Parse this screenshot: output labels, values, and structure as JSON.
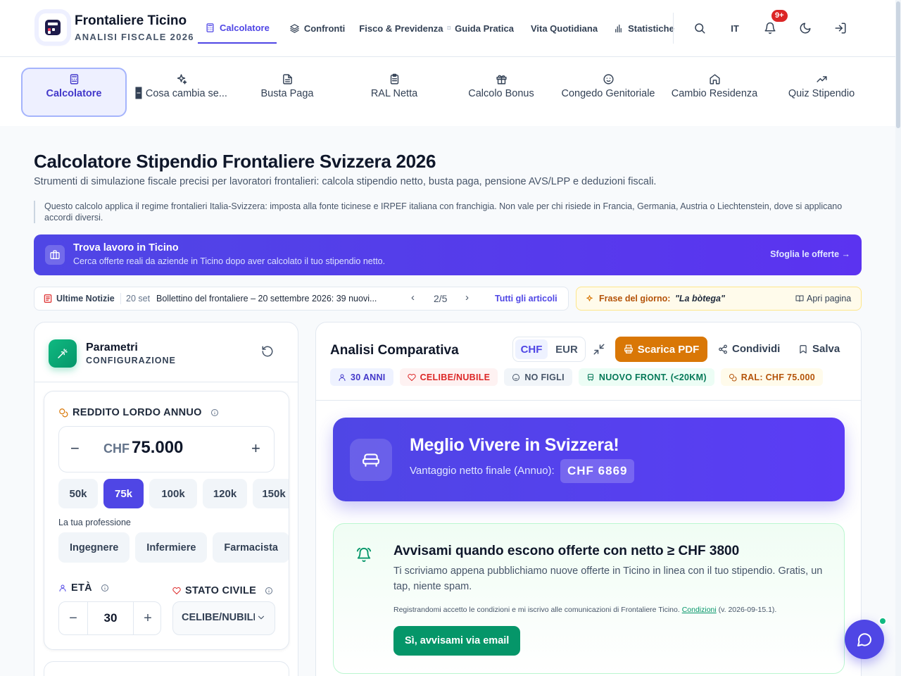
{
  "header": {
    "brand_name": "Frontaliere Ticino",
    "brand_sub": "ANALISI FISCALE 2026",
    "nav": [
      {
        "label": "Calcolatore",
        "icon": "calculator-icon",
        "active": true
      },
      {
        "label": "Confronti",
        "icon": "layers-icon"
      },
      {
        "label": "Fisco & Previdenza",
        "icon": ""
      },
      {
        "label": "Guida Pratica",
        "icon": ""
      },
      {
        "label": "Vita Quotidiana",
        "icon": ""
      },
      {
        "label": "Statistiche",
        "icon": "bar-chart-icon"
      }
    ],
    "lang": "IT",
    "notif_badge": "9+"
  },
  "tools": [
    {
      "label": "Calcolatore",
      "icon": "calculator-icon",
      "active": true
    },
    {
      "label": "🁢 Cosa cambia se...",
      "icon": "sparkles-icon"
    },
    {
      "label": "Busta Paga",
      "icon": "file-text-icon"
    },
    {
      "label": "RAL Netta",
      "icon": "clipboard-icon"
    },
    {
      "label": "Calcolo Bonus",
      "icon": "gift-icon"
    },
    {
      "label": "Congedo Genitoriale",
      "icon": "baby-icon"
    },
    {
      "label": "Cambio Residenza",
      "icon": "home-icon"
    },
    {
      "label": "Quiz Stipendio",
      "icon": "trending-up-icon"
    }
  ],
  "intro": {
    "title": "Calcolatore Stipendio Frontaliere Svizzera 2026",
    "subtitle": "Strumenti di simulazione fiscale precisi per lavoratori frontalieri: calcola stipendio netto, busta paga, pensione AVS/LPP e deduzioni fiscali.",
    "disclaimer": "Questo calcolo applica il regime frontalieri Italia-Svizzera: imposta alla fonte ticinese e IRPEF italiana con franchigia. Non vale per chi risiede in Francia, Germania, Austria o Liechtenstein, dove si applicano accordi diversi."
  },
  "job_banner": {
    "title": "Trova lavoro in Ticino",
    "desc": "Cerca offerte reali da aziende in Ticino dopo aver calcolato il tuo stipendio netto.",
    "link": "Sfoglia le offerte →"
  },
  "news": {
    "label": "Ultime Notizie",
    "date": "20 set",
    "headline": "Bollettino del frontaliere – 20 settembre 2026: 39 nuovi...",
    "pager": "2/5",
    "all_link": "Tutti gli articoli"
  },
  "phrase": {
    "label": "Frase del giorno:",
    "text": "\"La bòtega\"",
    "open": "Apri pagina"
  },
  "params": {
    "title": "Parametri",
    "subtitle": "CONFIGURAZIONE",
    "income_label": "REDDITO LORDO ANNUO",
    "currency": "CHF",
    "income_value": "75.000",
    "quick": [
      "50k",
      "75k",
      "100k",
      "120k",
      "150k"
    ],
    "quick_active": 1,
    "profession_label": "La tua professione",
    "professions": [
      "Ingegnere",
      "Infermiere",
      "Farmacista"
    ],
    "age_label": "ETÀ",
    "age_value": "30",
    "status_label": "STATO CIVILE",
    "status_value": "CELIBE/NUBILE"
  },
  "analysis": {
    "title": "Analisi Comparativa",
    "currencies": [
      "CHF",
      "EUR"
    ],
    "active_currency": "CHF",
    "pdf": "Scarica PDF",
    "share": "Condividi",
    "save": "Salva",
    "tags": [
      {
        "label": "30 ANNI",
        "icon": "user-icon",
        "color": "#4338ca",
        "bg": "#eef2ff"
      },
      {
        "label": "CELIBE/NUBILE",
        "icon": "heart-icon",
        "color": "#dc2626",
        "bg": "#fef2f2"
      },
      {
        "label": "NO FIGLI",
        "icon": "baby-icon",
        "color": "#475569",
        "bg": "#f1f5f9"
      },
      {
        "label": "NUOVO FRONT. (<20KM)",
        "icon": "bus-icon",
        "color": "#047857",
        "bg": "#ecfdf5"
      },
      {
        "label": "RAL: CHF 75.000",
        "icon": "coins-icon",
        "color": "#b45309",
        "bg": "#fffbeb"
      }
    ],
    "hero_title": "Meglio Vivere in Svizzera!",
    "hero_sub": "Vantaggio netto finale (Annuo):",
    "hero_value": "CHF 6869",
    "alert_title": "Avvisami quando escono offerte con netto ≥ CHF 3800",
    "alert_desc": "Ti scriviamo appena pubblichiamo nuove offerte in Ticino in linea con il tuo stipendio. Gratis, un tap, niente spam.",
    "alert_legal_pre": "Registrandomi accetto le condizioni e mi iscrivo alle comunicazioni di Frontaliere Ticino.",
    "alert_legal_link": "Condizioni",
    "alert_legal_post": "(v. 2026-09-15.1).",
    "alert_button": "Sì, avvisami via email"
  },
  "colors": {
    "accent": "#4f46e5",
    "success": "#059669",
    "warning": "#d97706"
  }
}
